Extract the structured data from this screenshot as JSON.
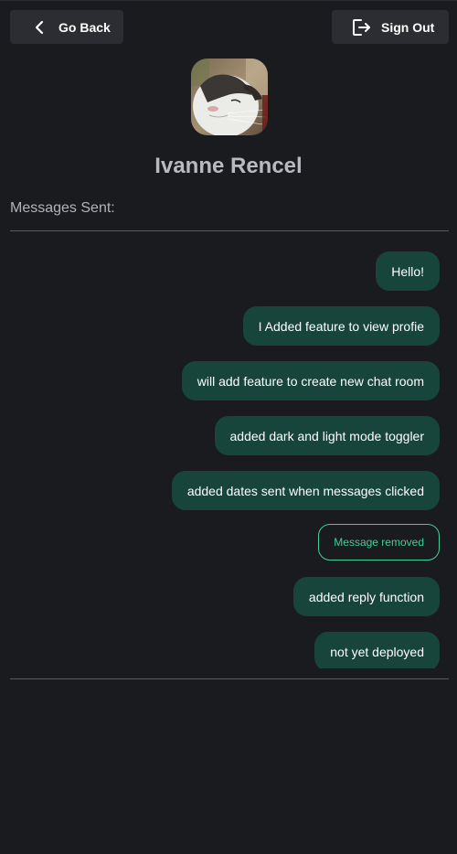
{
  "header": {
    "back_label": "Go Back",
    "back_icon": "chevron-left-icon",
    "signout_label": "Sign Out",
    "signout_icon": "sign-out-icon"
  },
  "profile": {
    "name": "Ivanne Rencel",
    "avatar": "cat-photo"
  },
  "messages_section": {
    "label": "Messages Sent:"
  },
  "messages": [
    {
      "text": "Hello!",
      "removed": false
    },
    {
      "text": "I Added feature to view profie",
      "removed": false
    },
    {
      "text": "will add feature to create new chat room",
      "removed": false
    },
    {
      "text": "added dark and light mode toggler",
      "removed": false
    },
    {
      "text": "added dates sent when messages clicked",
      "removed": false
    },
    {
      "text": "Message removed",
      "removed": true
    },
    {
      "text": "added reply function",
      "removed": false
    },
    {
      "text": "not yet deployed",
      "removed": false
    }
  ],
  "colors": {
    "background": "#1a1b1f",
    "button": "#2c2d32",
    "bubble": "#17443b",
    "removed_accent": "#3fcf97"
  }
}
